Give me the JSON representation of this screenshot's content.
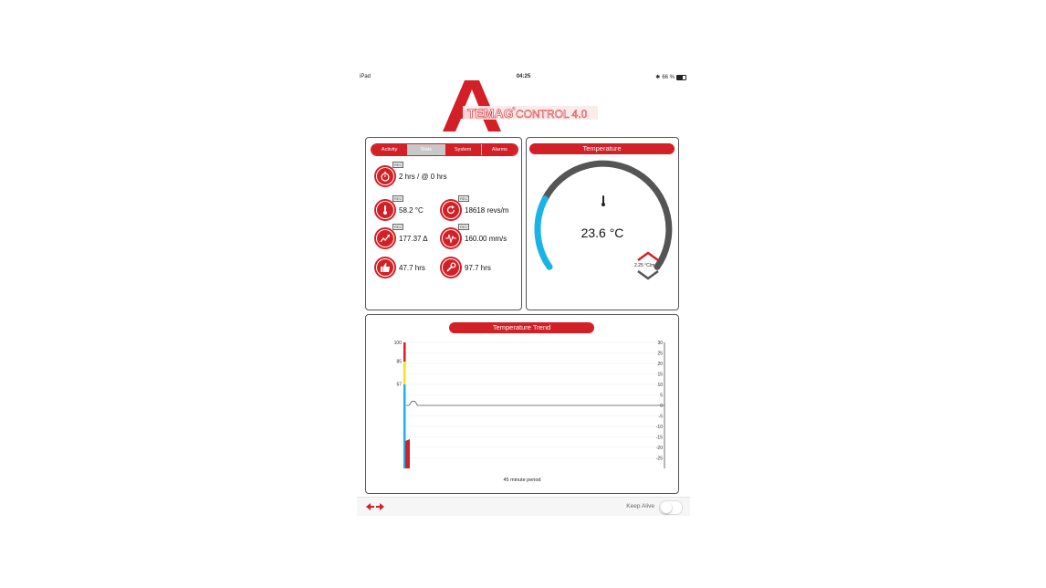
{
  "status_bar": {
    "device": "iPad",
    "time": "04:25",
    "battery": "66 %"
  },
  "logo": {
    "letter": "A",
    "brand": "TEMAG",
    "product": "CONTROL 4.0",
    "trademark": "®"
  },
  "stats_panel": {
    "tabs": [
      {
        "label": "Activity",
        "active": false
      },
      {
        "label": "Stats",
        "active": true
      },
      {
        "label": "System",
        "active": false
      },
      {
        "label": "Alarms",
        "active": false
      }
    ],
    "badge": "REC",
    "items": {
      "runtime": "2 hrs / @ 0 hrs",
      "temperature": "58.2 °C",
      "speed": "18618 revs/m",
      "trend": "177.37 Δ",
      "vibration": "160.00 mm/s",
      "usage": "47.7 hrs",
      "service": "97.7 hrs"
    }
  },
  "temperature_panel": {
    "title": "Temperature",
    "value": "23.6 °C",
    "rate": "2.25 °C/m",
    "gauge_fraction": 0.25,
    "gauge_colors": {
      "active": "#1ab3e8",
      "track": "#555555"
    }
  },
  "trend_panel": {
    "title": "Temperature Trend",
    "period_label": "45 minute period"
  },
  "footer": {
    "keep_alive_label": "Keep Alive",
    "keep_alive_on": false
  },
  "colors": {
    "accent": "#d32027",
    "cyan": "#1ab3e8",
    "yellow": "#f7e11a"
  },
  "chart_data": {
    "type": "line",
    "xlabel": "45 minute period",
    "left_axis": {
      "ticks": [
        100,
        85,
        67
      ],
      "ylim": [
        0,
        100
      ]
    },
    "right_axis": {
      "ticks": [
        30,
        25,
        20,
        15,
        10,
        5,
        0,
        -5,
        -10,
        -15,
        -20,
        -25
      ],
      "ylim": [
        -30,
        30
      ]
    },
    "series": [
      {
        "x": [
          0,
          0.5,
          1,
          1.5,
          2,
          45
        ],
        "y": [
          0,
          0,
          2,
          2,
          0,
          0
        ]
      }
    ]
  }
}
